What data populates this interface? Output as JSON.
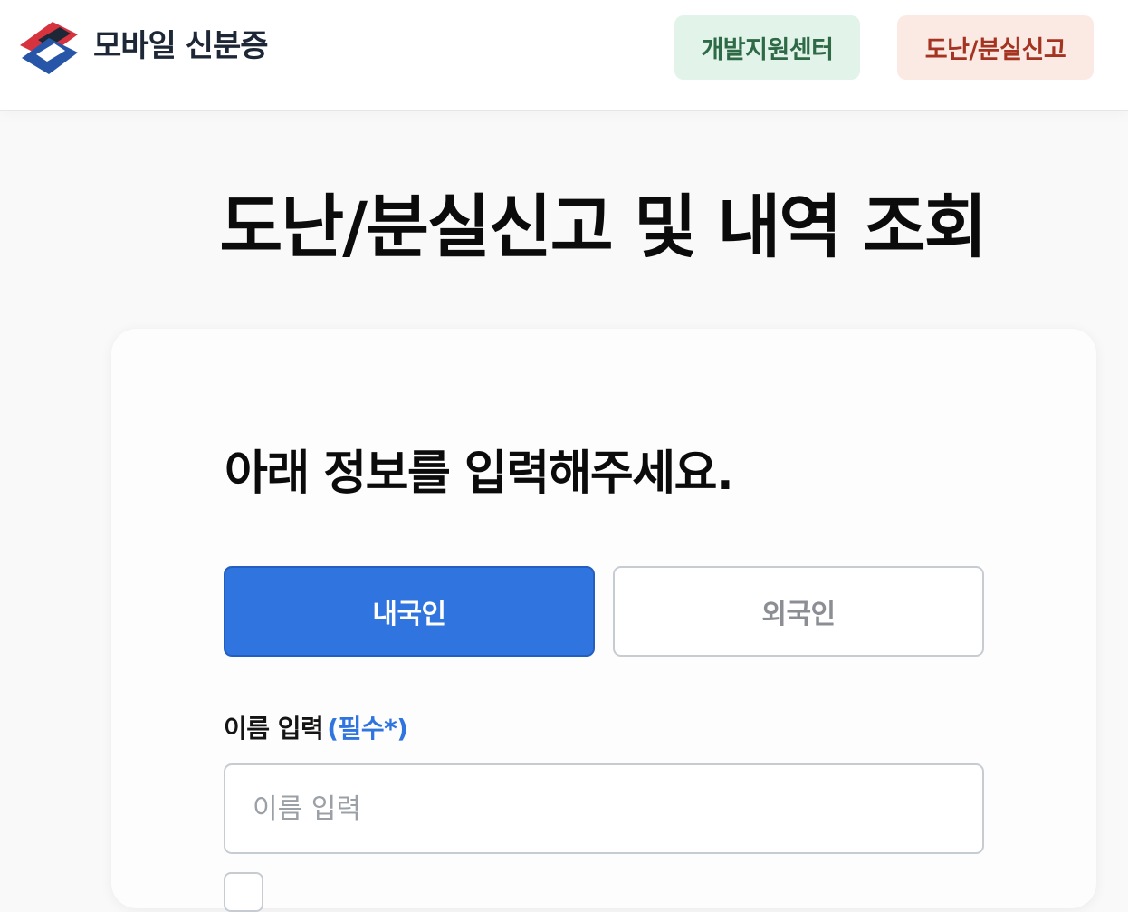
{
  "header": {
    "brand": "모바일 신분증",
    "logo_icon": "mobile-id-logo-icon",
    "nav": {
      "dev_center": "개발지원센터",
      "report": "도난/분실신고"
    }
  },
  "page": {
    "title": "도난/분실신고 및 내역 조회"
  },
  "form": {
    "heading": "아래 정보를 입력해주세요.",
    "tabs": {
      "domestic": "내국인",
      "foreign": "외국인",
      "selected": "내국인"
    },
    "name_label": "이름 입력",
    "name_required": "(필수*)",
    "name_placeholder": "이름 입력",
    "name_value": ""
  },
  "colors": {
    "accent": "#2f74df",
    "dev_bg": "#e2f3ea",
    "dev_text": "#2f6a47",
    "report_bg": "#fbeae3",
    "report_text": "#a43321",
    "logo_red": "#d6333f",
    "logo_blue": "#2756a8"
  }
}
